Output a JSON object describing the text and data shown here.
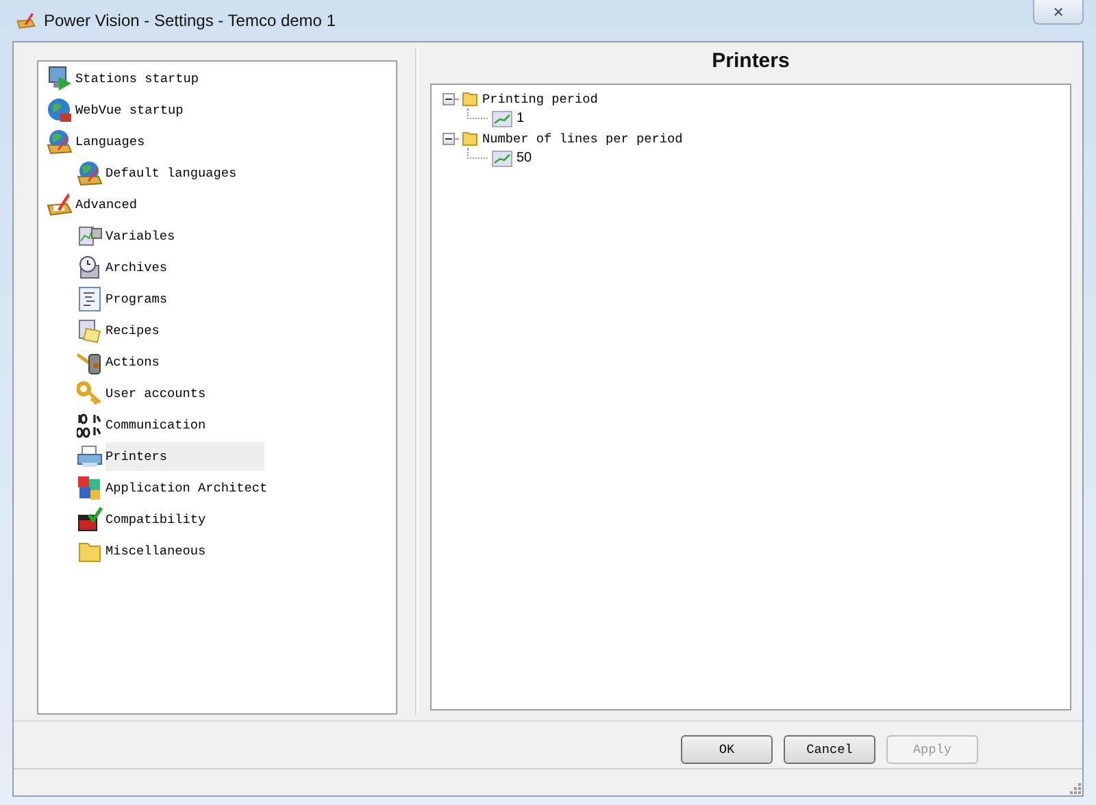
{
  "window": {
    "title": "Power Vision - Settings - Temco demo 1",
    "close": "×"
  },
  "sidebar": {
    "items": [
      {
        "label": "Stations startup",
        "selected": false
      },
      {
        "label": "WebVue startup",
        "selected": false
      },
      {
        "label": "Languages",
        "selected": false,
        "children": [
          {
            "label": "Default languages",
            "selected": false
          }
        ]
      },
      {
        "label": "Advanced",
        "selected": false,
        "children": [
          {
            "label": "Variables",
            "selected": false
          },
          {
            "label": "Archives",
            "selected": false
          },
          {
            "label": "Programs",
            "selected": false
          },
          {
            "label": "Recipes",
            "selected": false
          },
          {
            "label": "Actions",
            "selected": false
          },
          {
            "label": "User accounts",
            "selected": false
          },
          {
            "label": "Communication",
            "selected": false
          },
          {
            "label": "Printers",
            "selected": true
          },
          {
            "label": "Application Architect",
            "selected": false
          },
          {
            "label": "Compatibility",
            "selected": false
          },
          {
            "label": "Miscellaneous",
            "selected": false
          }
        ]
      }
    ]
  },
  "panel": {
    "title": "Printers",
    "tree": [
      {
        "label": "Printing period",
        "expanded": true,
        "children": [
          {
            "label": "1"
          }
        ]
      },
      {
        "label": "Number of lines per period",
        "expanded": true,
        "children": [
          {
            "label": "50"
          }
        ]
      }
    ]
  },
  "buttons": [
    {
      "label": "OK",
      "disabled": false
    },
    {
      "label": "Cancel",
      "disabled": false
    },
    {
      "label": "Apply",
      "disabled": true
    }
  ]
}
